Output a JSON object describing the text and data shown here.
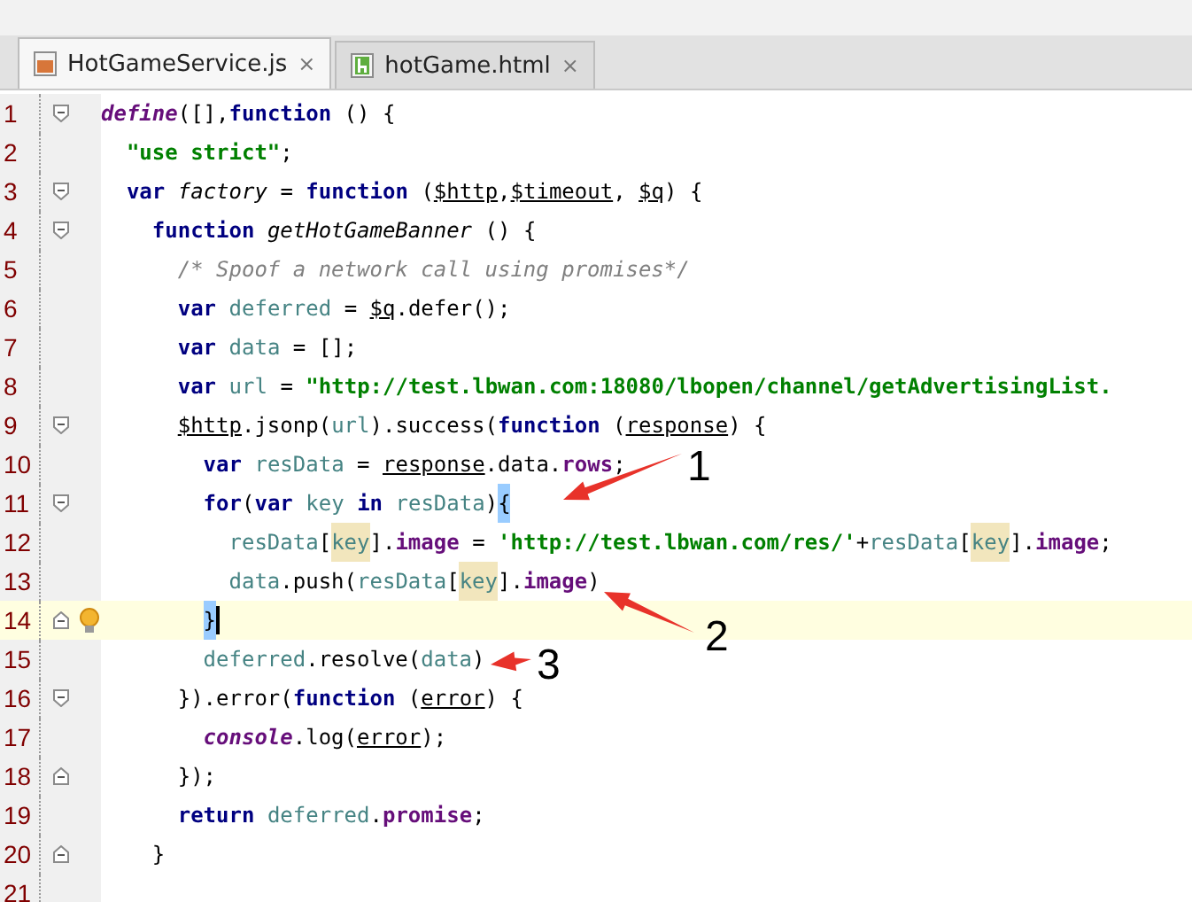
{
  "tabs": [
    {
      "label": "HotGameService.js",
      "kind": "js",
      "selected": true,
      "close": "×"
    },
    {
      "label": "hotGame.html",
      "kind": "html",
      "selected": false,
      "close": "×"
    }
  ],
  "lines": [
    {
      "number": "1",
      "fold": {
        "kind": "start"
      },
      "current": false,
      "hint": false,
      "cursor": false,
      "tokens": [
        {
          "t": "define",
          "kind": "builtin"
        },
        {
          "t": "([],",
          "kind": "p"
        },
        {
          "t": "function",
          "kind": "kw"
        },
        {
          "t": " () {",
          "kind": "p"
        }
      ]
    },
    {
      "number": "2",
      "current": false,
      "hint": false,
      "cursor": false,
      "tokens": [
        {
          "t": "  \"use strict\"",
          "kind": "str"
        },
        {
          "t": ";",
          "kind": "p"
        }
      ]
    },
    {
      "number": "3",
      "fold": {
        "kind": "start"
      },
      "current": false,
      "hint": false,
      "cursor": false,
      "tokens": [
        {
          "t": "  var ",
          "kind": "kw"
        },
        {
          "t": "factory",
          "kind": "decl"
        },
        {
          "t": " = ",
          "kind": "p"
        },
        {
          "t": "function",
          "kind": "kw"
        },
        {
          "t": " (",
          "kind": "p"
        },
        {
          "t": "$http",
          "kind": "param"
        },
        {
          "t": ",",
          "kind": "p"
        },
        {
          "t": "$timeout",
          "kind": "param"
        },
        {
          "t": ", ",
          "kind": "p"
        },
        {
          "t": "$q",
          "kind": "param"
        },
        {
          "t": ") {",
          "kind": "p"
        }
      ]
    },
    {
      "number": "4",
      "fold": {
        "kind": "start"
      },
      "current": false,
      "hint": false,
      "cursor": false,
      "tokens": [
        {
          "t": "    function ",
          "kind": "kw"
        },
        {
          "t": "getHotGameBanner",
          "kind": "decl"
        },
        {
          "t": " () {",
          "kind": "p"
        }
      ]
    },
    {
      "number": "5",
      "current": false,
      "hint": false,
      "cursor": false,
      "tokens": [
        {
          "t": "      /* Spoof a network call using promises*/",
          "kind": "cm"
        }
      ]
    },
    {
      "number": "6",
      "current": false,
      "hint": false,
      "cursor": false,
      "tokens": [
        {
          "t": "      var ",
          "kind": "kw"
        },
        {
          "t": "deferred",
          "kind": "var"
        },
        {
          "t": " = ",
          "kind": "p"
        },
        {
          "t": "$q",
          "kind": "param"
        },
        {
          "t": ".defer();",
          "kind": "p"
        }
      ]
    },
    {
      "number": "7",
      "current": false,
      "hint": false,
      "cursor": false,
      "tokens": [
        {
          "t": "      var ",
          "kind": "kw"
        },
        {
          "t": "data",
          "kind": "var"
        },
        {
          "t": " = [];",
          "kind": "p"
        }
      ]
    },
    {
      "number": "8",
      "current": false,
      "hint": false,
      "cursor": false,
      "tokens": [
        {
          "t": "      var ",
          "kind": "kw"
        },
        {
          "t": "url",
          "kind": "var"
        },
        {
          "t": " = ",
          "kind": "p"
        },
        {
          "t": "\"http://test.lbwan.com:18080/lbopen/channel/getAdvertisingList.",
          "kind": "str"
        }
      ]
    },
    {
      "number": "9",
      "fold": {
        "kind": "start"
      },
      "current": false,
      "hint": false,
      "cursor": false,
      "tokens": [
        {
          "t": "      $http",
          "kind": "param"
        },
        {
          "t": ".jsonp(",
          "kind": "p"
        },
        {
          "t": "url",
          "kind": "var"
        },
        {
          "t": ").success(",
          "kind": "p"
        },
        {
          "t": "function",
          "kind": "kw"
        },
        {
          "t": " (",
          "kind": "p"
        },
        {
          "t": "response",
          "kind": "param"
        },
        {
          "t": ") {",
          "kind": "p"
        }
      ]
    },
    {
      "number": "10",
      "current": false,
      "hint": false,
      "cursor": false,
      "tokens": [
        {
          "t": "        var ",
          "kind": "kw"
        },
        {
          "t": "resData",
          "kind": "var"
        },
        {
          "t": " = ",
          "kind": "p"
        },
        {
          "t": "response",
          "kind": "param"
        },
        {
          "t": ".data.",
          "kind": "p"
        },
        {
          "t": "rows",
          "kind": "prop"
        },
        {
          "t": ";",
          "kind": "p"
        }
      ]
    },
    {
      "number": "11",
      "fold": {
        "kind": "start"
      },
      "current": false,
      "hint": false,
      "cursor": false,
      "tokens": [
        {
          "t": "        for",
          "kind": "kw"
        },
        {
          "t": "(",
          "kind": "p"
        },
        {
          "t": "var ",
          "kind": "kw"
        },
        {
          "t": "key ",
          "kind": "var"
        },
        {
          "t": "in ",
          "kind": "kw"
        },
        {
          "t": "resData",
          "kind": "var"
        },
        {
          "t": ")",
          "kind": "p"
        },
        {
          "t": "{",
          "kind": "brace"
        }
      ]
    },
    {
      "number": "12",
      "current": false,
      "hint": false,
      "cursor": false,
      "tokens": [
        {
          "t": "          resData",
          "kind": "var"
        },
        {
          "t": "[",
          "kind": "p"
        },
        {
          "t": "key",
          "kind": "usage"
        },
        {
          "t": "].",
          "kind": "p"
        },
        {
          "t": "image",
          "kind": "prop"
        },
        {
          "t": " = ",
          "kind": "p"
        },
        {
          "t": "'http://test.lbwan.com/res/'",
          "kind": "str"
        },
        {
          "t": "+",
          "kind": "p"
        },
        {
          "t": "resData",
          "kind": "var"
        },
        {
          "t": "[",
          "kind": "p"
        },
        {
          "t": "key",
          "kind": "usage"
        },
        {
          "t": "].",
          "kind": "p"
        },
        {
          "t": "image",
          "kind": "prop"
        },
        {
          "t": ";",
          "kind": "p"
        }
      ]
    },
    {
      "number": "13",
      "current": false,
      "hint": false,
      "cursor": false,
      "tokens": [
        {
          "t": "          data",
          "kind": "var"
        },
        {
          "t": ".push(",
          "kind": "p"
        },
        {
          "t": "resData",
          "kind": "var"
        },
        {
          "t": "[",
          "kind": "p"
        },
        {
          "t": "key",
          "kind": "usage"
        },
        {
          "t": "].",
          "kind": "p"
        },
        {
          "t": "image",
          "kind": "prop"
        },
        {
          "t": ")",
          "kind": "p"
        }
      ]
    },
    {
      "number": "14",
      "fold": {
        "kind": "end"
      },
      "current": true,
      "hint": true,
      "cursor": true,
      "tokens": [
        {
          "t": "        }",
          "kind": "brace"
        }
      ]
    },
    {
      "number": "15",
      "current": false,
      "hint": false,
      "cursor": false,
      "tokens": [
        {
          "t": "        deferred",
          "kind": "var"
        },
        {
          "t": ".resolve(",
          "kind": "p"
        },
        {
          "t": "data",
          "kind": "var"
        },
        {
          "t": ")",
          "kind": "p"
        }
      ]
    },
    {
      "number": "16",
      "fold": {
        "kind": "start"
      },
      "current": false,
      "hint": false,
      "cursor": false,
      "tokens": [
        {
          "t": "      }).error(",
          "kind": "p"
        },
        {
          "t": "function",
          "kind": "kw"
        },
        {
          "t": " (",
          "kind": "p"
        },
        {
          "t": "error",
          "kind": "param"
        },
        {
          "t": ") {",
          "kind": "p"
        }
      ]
    },
    {
      "number": "17",
      "current": false,
      "hint": false,
      "cursor": false,
      "tokens": [
        {
          "t": "        console",
          "kind": "builtin"
        },
        {
          "t": ".log(",
          "kind": "p"
        },
        {
          "t": "error",
          "kind": "param"
        },
        {
          "t": ");",
          "kind": "p"
        }
      ]
    },
    {
      "number": "18",
      "fold": {
        "kind": "end"
      },
      "current": false,
      "hint": false,
      "cursor": false,
      "tokens": [
        {
          "t": "      });",
          "kind": "p"
        }
      ]
    },
    {
      "number": "19",
      "current": false,
      "hint": false,
      "cursor": false,
      "tokens": [
        {
          "t": "      return ",
          "kind": "kw"
        },
        {
          "t": "deferred",
          "kind": "var"
        },
        {
          "t": ".",
          "kind": "p"
        },
        {
          "t": "promise",
          "kind": "prop"
        },
        {
          "t": ";",
          "kind": "p"
        }
      ]
    },
    {
      "number": "20",
      "fold": {
        "kind": "end"
      },
      "current": false,
      "hint": false,
      "cursor": false,
      "tokens": [
        {
          "t": "    }",
          "kind": "p"
        }
      ]
    },
    {
      "number": "21",
      "current": false,
      "hint": false,
      "cursor": false
    }
  ],
  "annotations": [
    {
      "label": "1"
    },
    {
      "label": "2"
    },
    {
      "label": "3"
    }
  ]
}
